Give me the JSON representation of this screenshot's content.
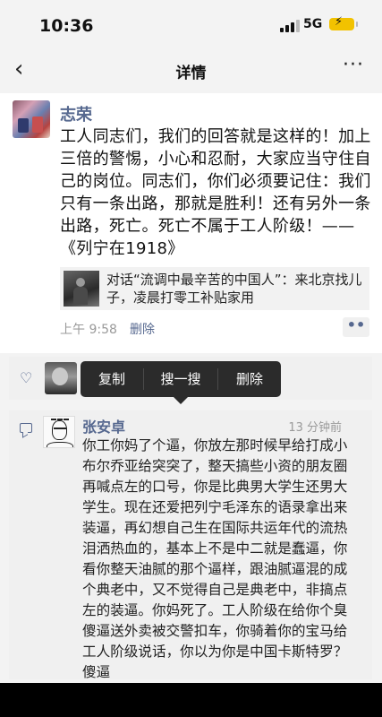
{
  "status_bar": {
    "time": "10:36",
    "network": "5G"
  },
  "nav": {
    "title": "详情",
    "back_icon": "chevron-left-icon",
    "more_icon": "more-dots-icon",
    "more_text": "···"
  },
  "post": {
    "author": "志荣",
    "text": "工人同志们，我们的回答就是这样的！加上三倍的警惕，小心和忍耐，大家应当守住自己的岗位。同志们，你们必须要记住：我们只有一条出路，那就是胜利！还有另外一条出路，死亡。死亡不属于工人阶级！——《列宁在1918》",
    "link_card": {
      "text": "对话“流调中最辛苦的中国人”：来北京找儿子，凌晨打零工补贴家用"
    },
    "time": "上午 9:58",
    "delete_label": "删除",
    "actions_text": "••"
  },
  "context_menu": {
    "copy": "复制",
    "search": "搜一搜",
    "delete": "删除"
  },
  "comment": {
    "author": "张安卓",
    "time": "13 分钟前",
    "text": "你工你妈了个逼，你放左那时候早给打成小布尔乔亚给突突了，整天搞些小资的朋友圈再喊点左的口号，你是比典男大学生还男大学生。现在还爱把列宁毛泽东的语录拿出来装逼，再幻想自己生在国际共运年代的流热泪洒热血的，基本上不是中二就是蠢逼，你看你整天油腻的那个逼样，跟油腻逼混的成个典老中，又不觉得自己是典老中，非搞点左的装逼。你妈死了。工人阶级在给你个臭傻逼送外卖被交警扣车，你骑着你的宝马给工人阶级说话，你以为你是中国卡斯特罗？傻逼"
  },
  "colors": {
    "link": "#56688f",
    "battery": "#f2c200",
    "menu_bg": "#2b2b2b"
  }
}
